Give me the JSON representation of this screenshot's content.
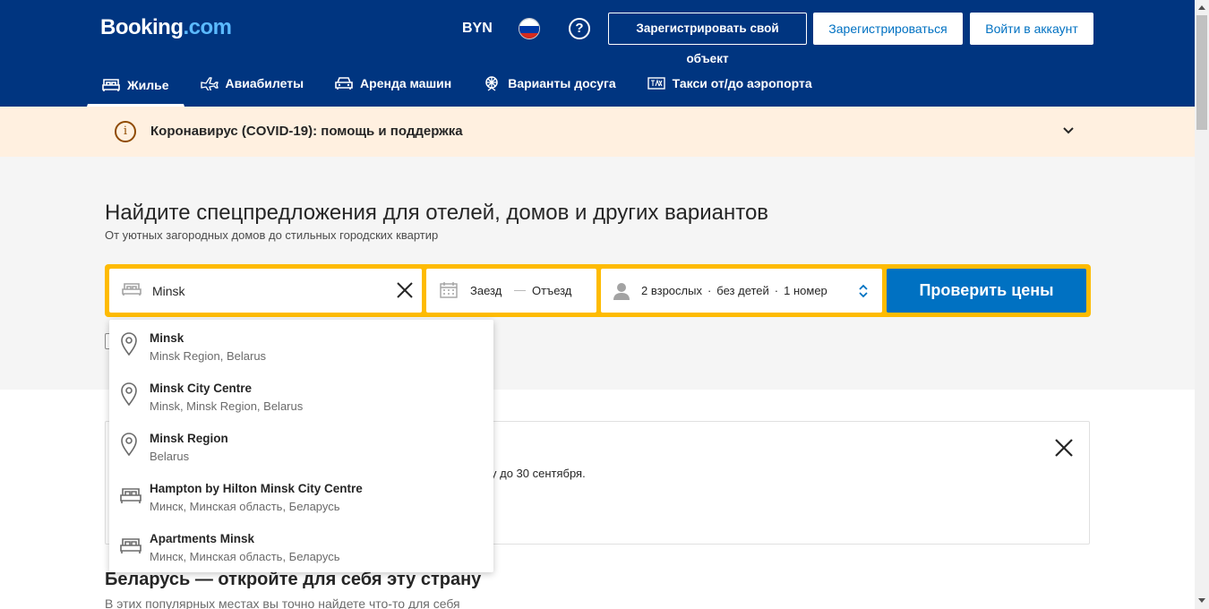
{
  "header": {
    "logo_main": "Booking",
    "logo_dot": ".com",
    "currency": "BYN",
    "help_glyph": "?",
    "list_property": "Зарегистрировать свой объект",
    "register": "Зарегистрироваться",
    "login": "Войти в аккаунт",
    "nav": [
      {
        "label": "Жилье",
        "icon": "bed-icon"
      },
      {
        "label": "Авиабилеты",
        "icon": "plane-icon"
      },
      {
        "label": "Аренда машин",
        "icon": "car-icon"
      },
      {
        "label": "Варианты досуга",
        "icon": "attractions-icon"
      },
      {
        "label": "Такси от/до аэропорта",
        "icon": "taxi-icon"
      }
    ]
  },
  "covid": {
    "text": "Коронавирус (COVID-19): помощь и поддержка"
  },
  "hero": {
    "title": "Найдите спецпредложения для отелей, домов и других вариантов",
    "subtitle": "От уютных загородных домов до стильных городских квартир"
  },
  "search": {
    "destination_value": "Minsk",
    "checkin": "Заезд",
    "dash": "—",
    "checkout": "Отъезд",
    "adults": "2 взрослых",
    "children": "без детей",
    "rooms": "1 номер",
    "sep": "·",
    "submit": "Проверить цены"
  },
  "suggestions": [
    {
      "name": "Minsk",
      "location": "Minsk Region, Belarus",
      "icon": "map-pin-icon"
    },
    {
      "name": "Minsk City Centre",
      "location": "Minsk, Minsk Region, Belarus",
      "icon": "map-pin-icon"
    },
    {
      "name": "Minsk Region",
      "location": "Belarus",
      "icon": "map-pin-icon"
    },
    {
      "name": "Hampton by Hilton Minsk City Centre",
      "location": "Минск, Минская область, Беларусь",
      "icon": "bed-icon"
    },
    {
      "name": "Apartments Minsk",
      "location": "Минск, Минская область, Беларусь",
      "icon": "bed-icon"
    }
  ],
  "info": {
    "partial_text": "у до 30 сентября."
  },
  "section": {
    "title": "Беларусь — откройте для себя эту страну",
    "subtitle": "В этих популярных местах вы точно найдете что-то для себя"
  },
  "colors": {
    "brand_blue": "#003580",
    "accent_yellow": "#febb02",
    "action_blue": "#0071c2",
    "covid_bg": "#fff0e0"
  }
}
